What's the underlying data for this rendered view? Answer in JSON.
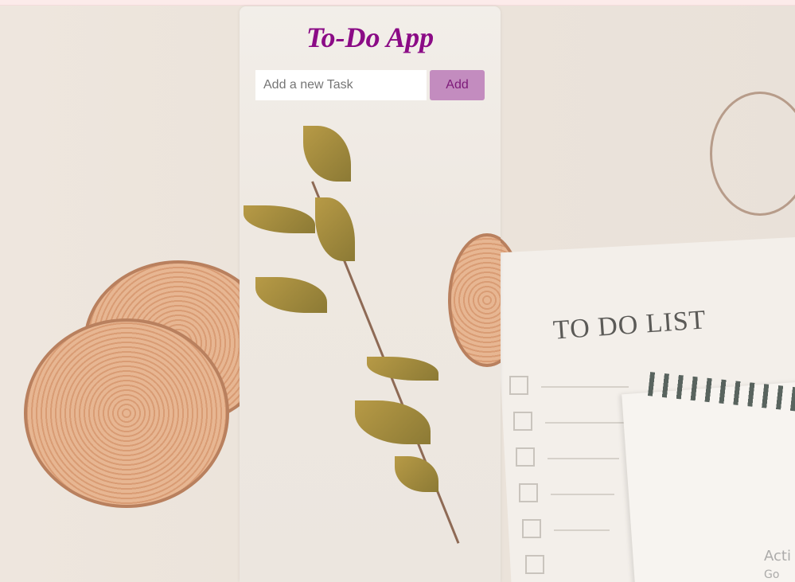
{
  "app": {
    "title": "To-Do App"
  },
  "task_input": {
    "value": "",
    "placeholder": "Add a new Task"
  },
  "add_button": {
    "label": "Add"
  },
  "background_photo": {
    "notepad_heading": "TO DO LIST"
  },
  "os_watermark": {
    "line1": "Acti",
    "line2": "Go"
  },
  "colors": {
    "title": "#8b0b86",
    "button_bg": "#c38cbf",
    "button_text": "#7d1a79"
  }
}
